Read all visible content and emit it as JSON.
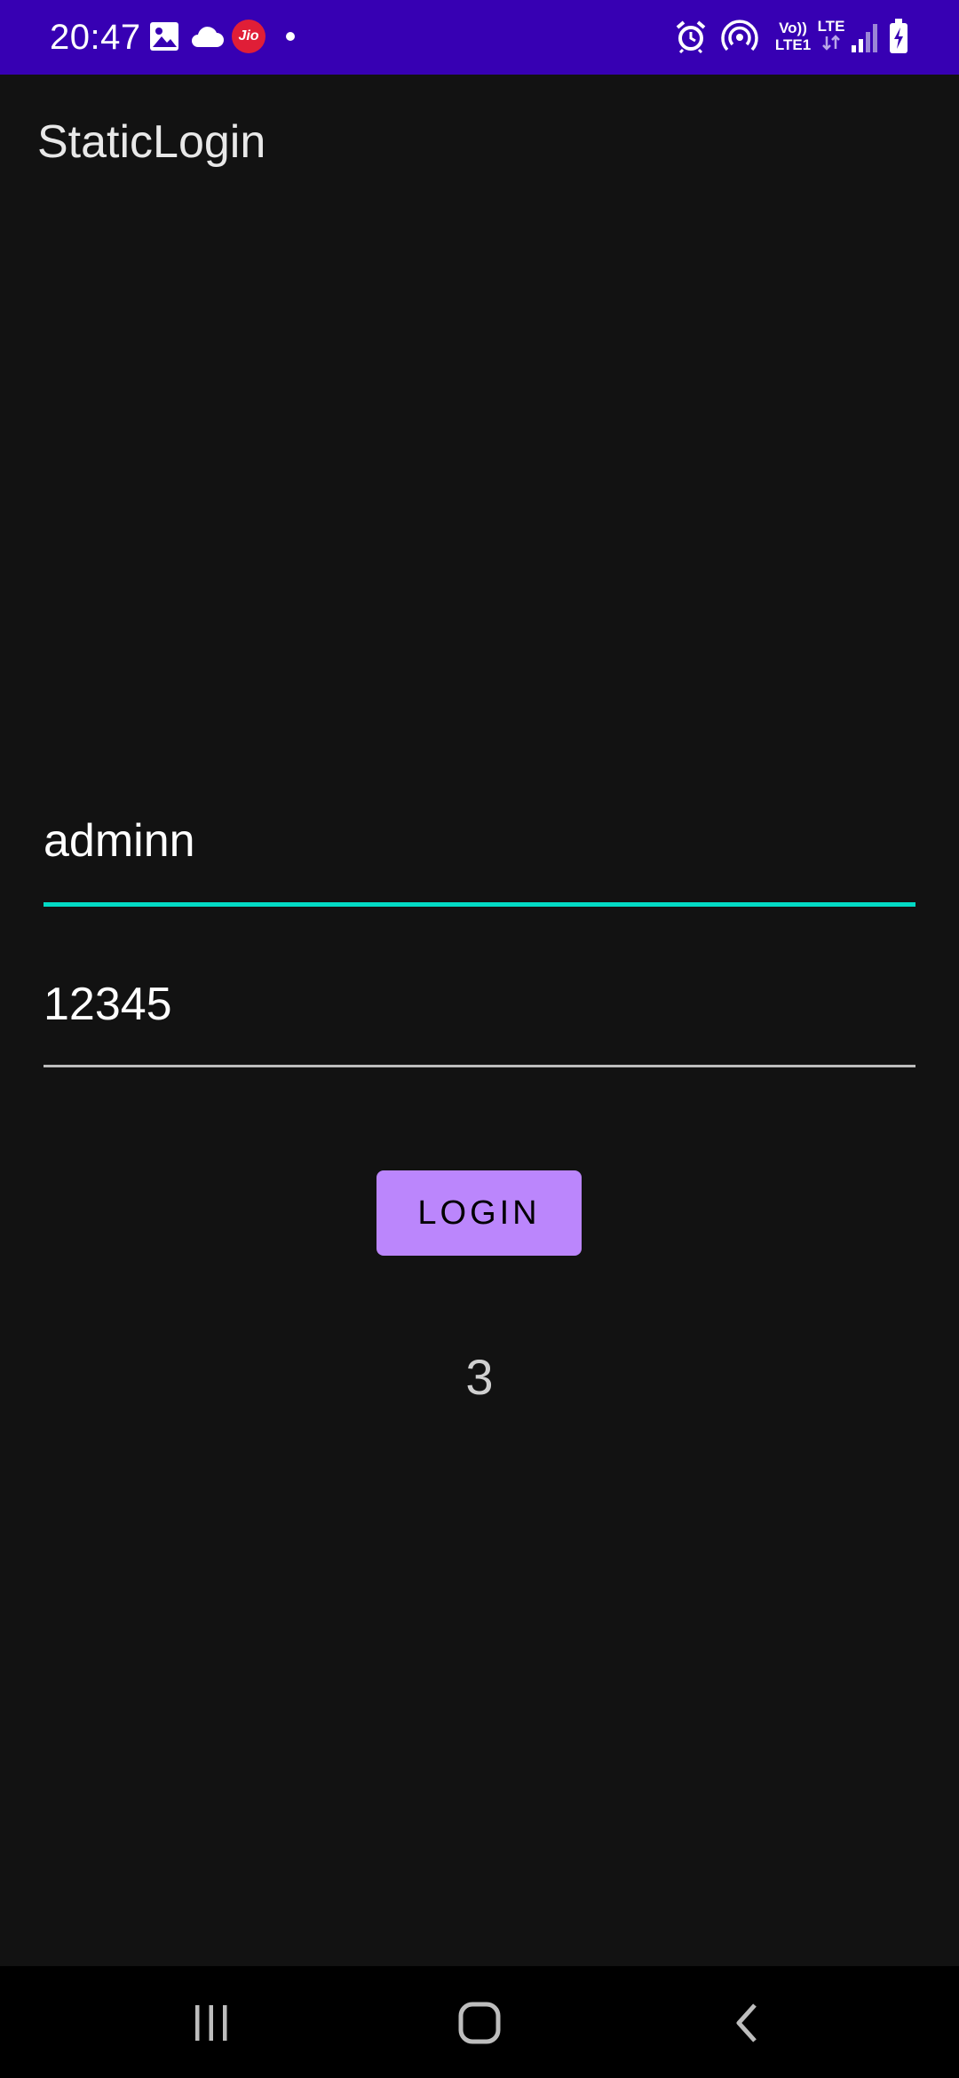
{
  "status_bar": {
    "time": "20:47",
    "icons": [
      "image-icon",
      "cloud-icon",
      "jio-icon",
      "dot-icon",
      "alarm-icon",
      "hotspot-icon",
      "volte-icon",
      "lte-icon",
      "signal-icon",
      "battery-icon"
    ],
    "volte_line1": "Vo))",
    "volte_line2": "LTE1",
    "lte_label": "LTE",
    "jio_label": "Jio",
    "color": "#3700B3"
  },
  "app_bar": {
    "title": "StaticLogin"
  },
  "form": {
    "username_value": "adminn",
    "password_value": "12345",
    "login_label": "LOGIN",
    "attempts_left": "3",
    "accent_color": "#03DAC5",
    "button_color": "#BB86FC"
  },
  "nav_bar": {
    "buttons": [
      "recents-icon",
      "home-icon",
      "back-icon"
    ]
  }
}
